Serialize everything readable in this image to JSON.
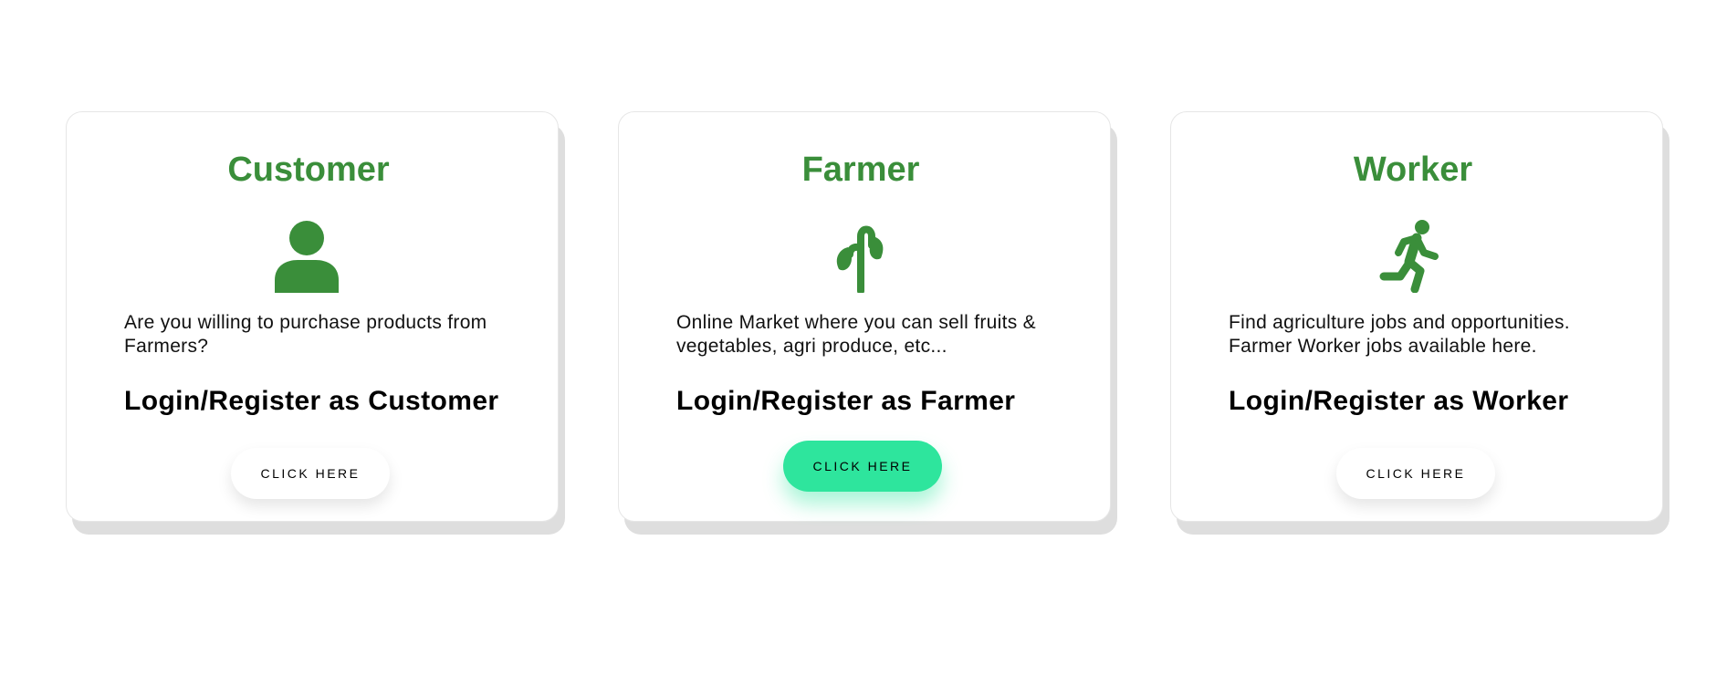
{
  "colors": {
    "title_green": "#3a8e3a",
    "button_active": "#2ee59d",
    "button_default": "#ffffff"
  },
  "cards": [
    {
      "title": "Customer",
      "icon": "person-icon",
      "description": "Are you willing to purchase products from Farmers?",
      "cta": "Login/Register as Customer",
      "button_label": "CLICK HERE"
    },
    {
      "title": "Farmer",
      "icon": "sprout-icon",
      "description": "Online Market where you can sell fruits & vegetables, agri produce, etc...",
      "cta": "Login/Register as Farmer",
      "button_label": "CLICK HERE",
      "button_state": "hover"
    },
    {
      "title": "Worker",
      "icon": "running-person-icon",
      "description": "Find agriculture jobs and opportunities. Farmer Worker jobs available here.",
      "cta": "Login/Register as Worker",
      "button_label": "CLICK HERE"
    }
  ]
}
